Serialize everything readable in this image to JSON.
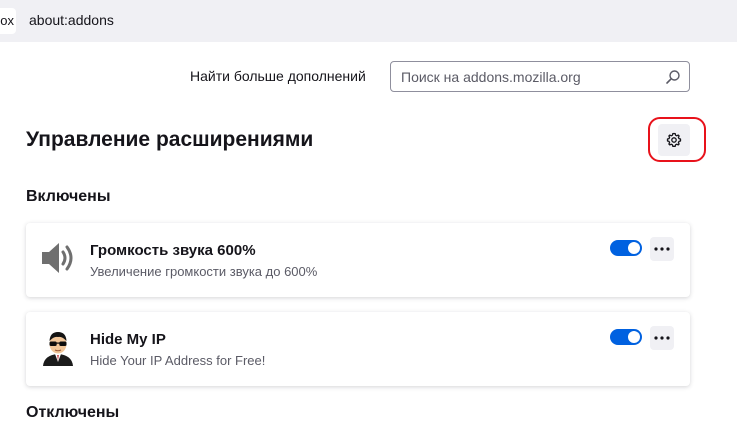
{
  "browser": {
    "tab_fragment": "ox",
    "url": "about:addons"
  },
  "header": {
    "find_more_label": "Найти больше дополнений",
    "search_placeholder": "Поиск на addons.mozilla.org",
    "search_value": ""
  },
  "page": {
    "title": "Управление расширениями"
  },
  "sections": {
    "enabled_label": "Включены",
    "disabled_label": "Отключены"
  },
  "extensions": [
    {
      "name": "Громкость звука 600%",
      "description": "Увеличение громкости звука до 600%",
      "icon": "speaker-icon",
      "enabled": true
    },
    {
      "name": "Hide My IP",
      "description": "Hide Your IP Address for Free!",
      "icon": "spy-avatar-icon",
      "enabled": true
    }
  ],
  "colors": {
    "accent": "#0061e0",
    "highlight": "#e8121b"
  }
}
